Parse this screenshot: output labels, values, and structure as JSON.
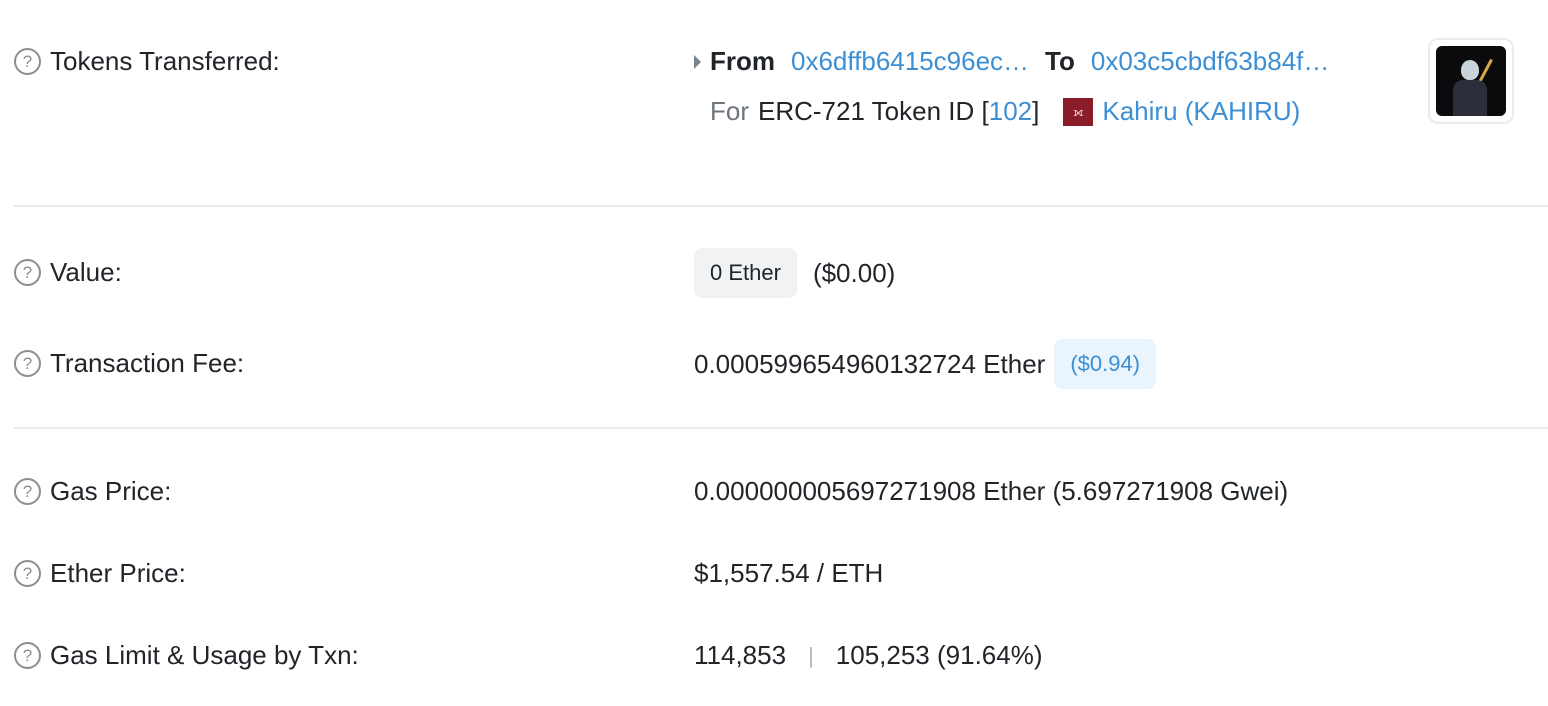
{
  "tokens_transferred": {
    "label": "Tokens Transferred:",
    "from_label": "From",
    "from_address": "0x6dffb6415c96ec…",
    "to_label": "To",
    "to_address": "0x03c5cbdf63b84f…",
    "for_label": "For",
    "token_standard": "ERC-721 Token ID [",
    "token_id": "102",
    "token_id_close": "]",
    "token_name": "Kahiru (KAHIRU)"
  },
  "value": {
    "label": "Value:",
    "amount": "0 Ether",
    "usd": "($0.00)"
  },
  "transaction_fee": {
    "label": "Transaction Fee:",
    "amount": "0.000599654960132724 Ether",
    "usd": "($0.94)"
  },
  "gas_price": {
    "label": "Gas Price:",
    "amount": "0.000000005697271908 Ether (5.697271908 Gwei)"
  },
  "ether_price": {
    "label": "Ether Price:",
    "amount": "$1,557.54 / ETH"
  },
  "gas_limit": {
    "label": "Gas Limit & Usage by Txn:",
    "limit": "114,853",
    "separator": "|",
    "usage": "105,253 (91.64%)"
  },
  "help_glyph": "?",
  "colors": {
    "link": "#3d8fd4",
    "muted": "#6c757d",
    "divider": "#e9ecef",
    "token_logo": "#8b1d2a"
  }
}
